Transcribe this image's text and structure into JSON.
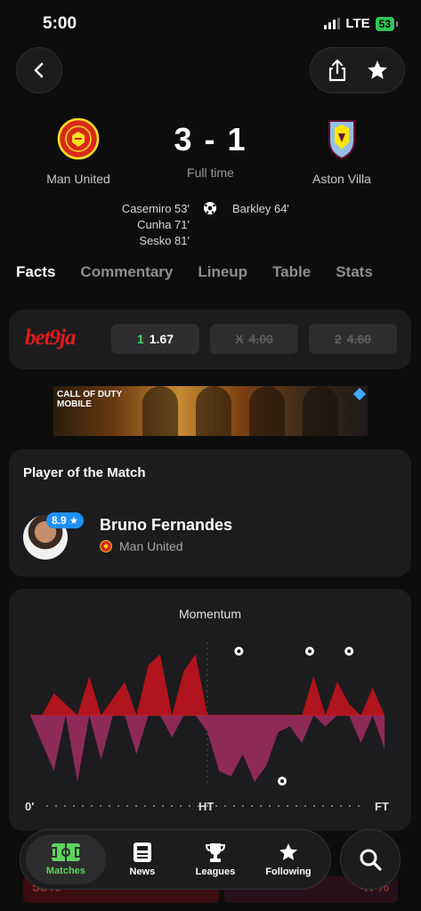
{
  "status_bar": {
    "time": "5:00",
    "network": "LTE",
    "battery": "53"
  },
  "match": {
    "home": {
      "name": "Man United",
      "crest_icon": "man-united-crest-icon",
      "scorers": [
        "Casemiro 53'",
        "Cunha 71'",
        "Sesko 81'"
      ]
    },
    "away": {
      "name": "Aston Villa",
      "crest_icon": "aston-villa-crest-icon",
      "scorers": [
        "Barkley 64'"
      ]
    },
    "score": "3 - 1",
    "status": "Full time"
  },
  "tabs": [
    "Facts",
    "Commentary",
    "Lineup",
    "Table",
    "Stats"
  ],
  "betting": {
    "brand": {
      "part1": "bet",
      "part2": "9ja"
    },
    "odds": [
      {
        "label": "1",
        "value": "1.67",
        "available": true
      },
      {
        "label": "X",
        "value": "4.00",
        "available": false
      },
      {
        "label": "2",
        "value": "4.60",
        "available": false
      }
    ]
  },
  "ad": {
    "title_line1": "CALL OF DUTY",
    "title_line2": "MOBILE"
  },
  "player_of_match": {
    "title": "Player of the Match",
    "rating": "8.9",
    "name": "Bruno Fernandes",
    "team": "Man United"
  },
  "momentum": {
    "title": "Momentum",
    "x_labels": {
      "start": "0'",
      "half": "HT",
      "end": "FT"
    },
    "colors": {
      "home": "#b0141c",
      "away": "#8e2a5a"
    }
  },
  "chart_data": {
    "type": "area",
    "title": "Momentum",
    "x_labels": [
      "0'",
      "HT",
      "FT"
    ],
    "x": [
      0,
      3,
      6,
      9,
      12,
      15,
      18,
      21,
      24,
      27,
      30,
      33,
      36,
      39,
      42,
      45,
      48,
      51,
      54,
      57,
      60,
      63,
      66,
      69,
      72,
      75,
      78,
      81,
      84,
      87,
      90
    ],
    "series": [
      {
        "name": "Man United",
        "values": [
          0,
          0,
          20,
          10,
          0,
          35,
          0,
          15,
          30,
          0,
          45,
          55,
          0,
          40,
          55,
          0,
          0,
          0,
          0,
          0,
          0,
          0,
          0,
          0,
          35,
          0,
          30,
          10,
          0,
          25,
          0
        ]
      },
      {
        "name": "Aston Villa",
        "values": [
          0,
          -25,
          -50,
          0,
          -60,
          0,
          -40,
          0,
          0,
          -35,
          0,
          0,
          -20,
          0,
          0,
          -15,
          -50,
          -55,
          -35,
          -60,
          -45,
          -15,
          -10,
          -25,
          0,
          -10,
          0,
          0,
          -25,
          0,
          -30
        ]
      }
    ],
    "goal_minutes": {
      "home": [
        53,
        71,
        81
      ],
      "away": [
        64
      ]
    },
    "ylim": [
      -65,
      65
    ]
  },
  "bottom_nav": [
    {
      "label": "Matches",
      "icon": "pitch-icon",
      "active": true
    },
    {
      "label": "News",
      "icon": "news-icon",
      "active": false
    },
    {
      "label": "Leagues",
      "icon": "trophy-icon",
      "active": false
    },
    {
      "label": "Following",
      "icon": "star-icon",
      "active": false
    }
  ],
  "possession_peek": {
    "home": "53%",
    "away": "47%"
  }
}
